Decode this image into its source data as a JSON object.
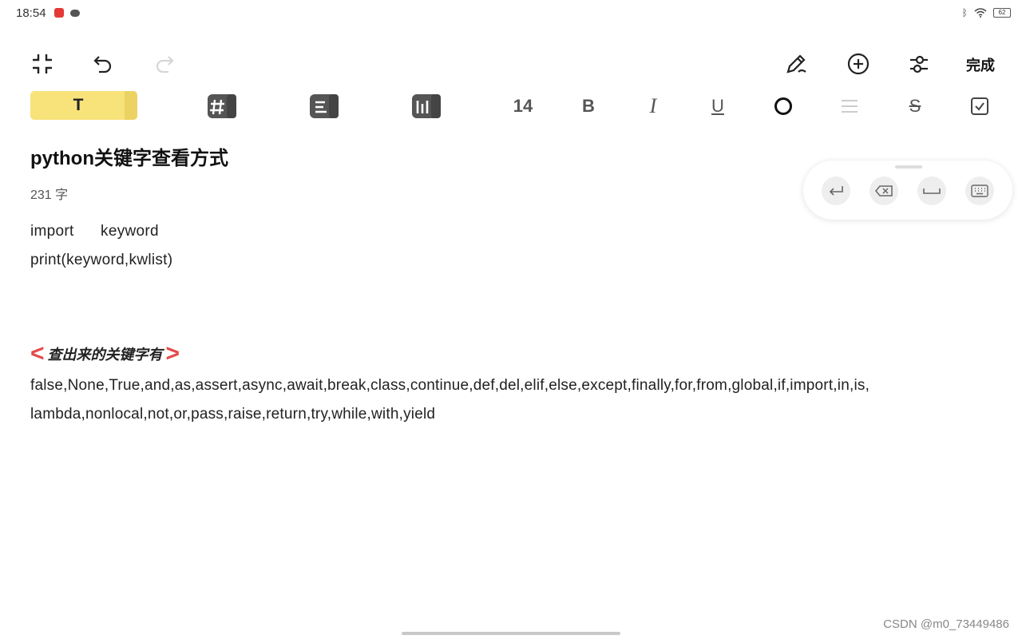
{
  "status_bar": {
    "time": "18:54",
    "battery": "62",
    "icons": [
      "app-notification-icon",
      "wechat-icon",
      "bluetooth-icon",
      "wifi-icon",
      "battery-icon"
    ]
  },
  "toolbar": {
    "done_label": "完成",
    "icons": [
      "collapse-icon",
      "undo-icon",
      "redo-icon",
      "handwriting-icon",
      "add-icon",
      "settings-icon"
    ]
  },
  "format_bar": {
    "text_style_label": "T",
    "font_size": "14",
    "bold_label": "B",
    "italic_label": "I",
    "underline_label": "U",
    "strike_label": "S",
    "highlight_color": "#f8e27a"
  },
  "document": {
    "title": "python关键字查看方式",
    "word_count": "231 字",
    "code_lines": [
      "import      keyword",
      "print(keyword,kwlist)"
    ],
    "section_heading": "查出来的关键字有",
    "keyword_lines": [
      "false,None,True,and,as,assert,async,await,break,class,continue,def,del,elif,else,except,finally,for,from,global,if,import,in,is,",
      "lambda,nonlocal,not,or,pass,raise,return,try,while,with,yield"
    ]
  },
  "keyboard_panel": {
    "icons": [
      "enter-icon",
      "backspace-icon",
      "space-icon",
      "keyboard-icon"
    ]
  },
  "watermark": "CSDN @m0_73449486",
  "accent_color": "#e44a4a"
}
